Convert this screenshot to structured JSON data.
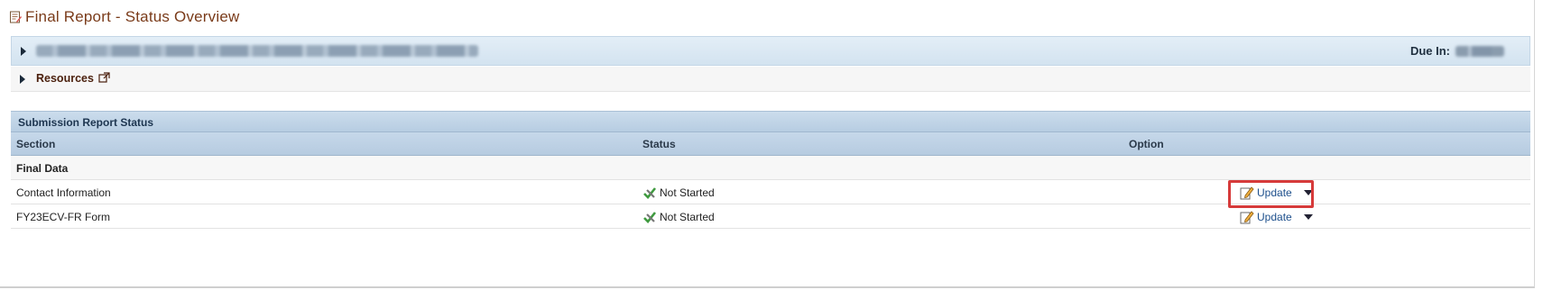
{
  "page": {
    "title": "Final Report - Status Overview"
  },
  "info_bar": {
    "due_label": "Due In:"
  },
  "resources": {
    "label": "Resources"
  },
  "panel": {
    "title": "Submission Report Status",
    "columns": [
      "Section",
      "Status",
      "Option"
    ],
    "group": "Final Data",
    "rows": [
      {
        "section": "Contact Information",
        "status": "Not Started",
        "option": "Update"
      },
      {
        "section": "FY23ECV-FR Form",
        "status": "Not Started",
        "option": "Update"
      }
    ]
  },
  "colors": {
    "title": "#7a3b1a",
    "link": "#1d4f8c",
    "highlight": "#d63a3a",
    "header": "#b7cde2"
  },
  "icons": [
    "report-icon",
    "triangle-right-icon",
    "external-link-icon",
    "not-started-icon",
    "edit-icon",
    "chevron-down-icon"
  ]
}
